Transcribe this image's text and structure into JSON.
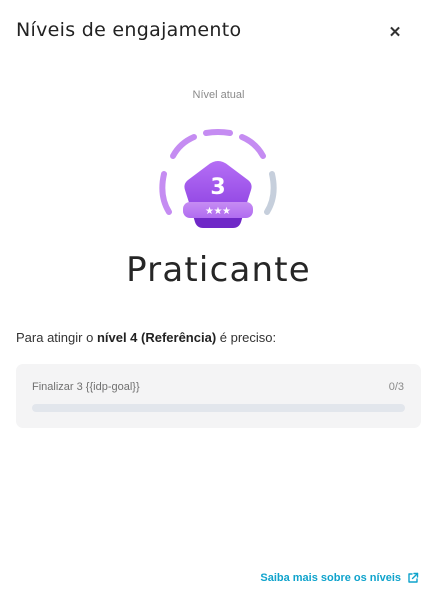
{
  "dialog": {
    "title": "Níveis de engajamento",
    "close_icon": "close-icon"
  },
  "current_level": {
    "caption": "Nível atual",
    "number": "3",
    "name": "Praticante",
    "badge_colors": {
      "primary": "#9d4ee8",
      "light": "#c58cf2",
      "inactive": "#c6cfdc"
    }
  },
  "requirements": {
    "prefix": "Para atingir o ",
    "level_label": "nível 4 (Referência)",
    "suffix": " é preciso:"
  },
  "goal": {
    "label": "Finalizar 3 {{idp-goal}}",
    "count": "0/3",
    "progress": 0
  },
  "footer": {
    "learn_more": "Saiba mais sobre os níveis",
    "link_icon": "external-link-icon",
    "accent": "#0fa3cc"
  }
}
